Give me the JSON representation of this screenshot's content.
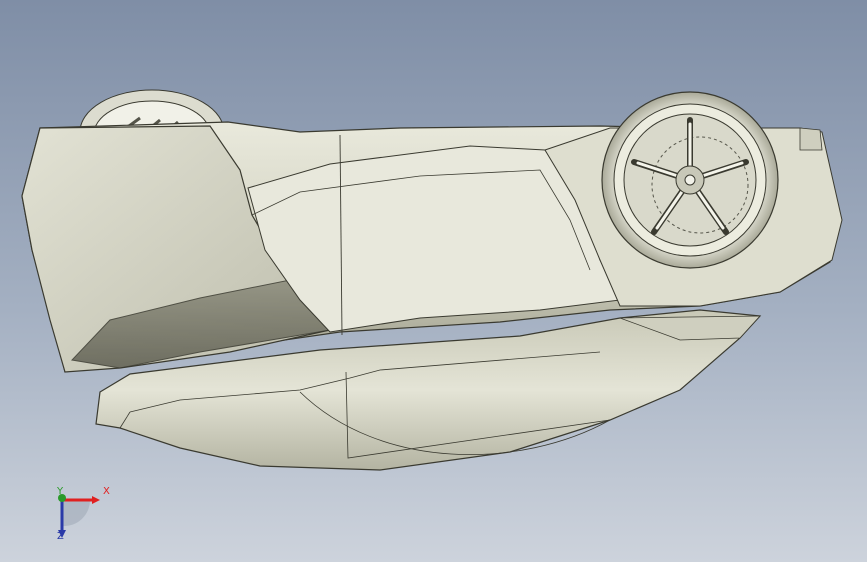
{
  "viewport": {
    "background_top": "#7f8ea6",
    "background_bottom": "#cdd3dc"
  },
  "model": {
    "body_color": "#d6d6c6",
    "edge_color": "#3a3a30",
    "wheel_icon": "wheel-icon"
  },
  "triad": {
    "x_label": "X",
    "y_label": "Y",
    "z_label": "Z",
    "x_color": "#e02020",
    "y_color": "#2a9a2a",
    "z_color": "#2a3aa8"
  }
}
